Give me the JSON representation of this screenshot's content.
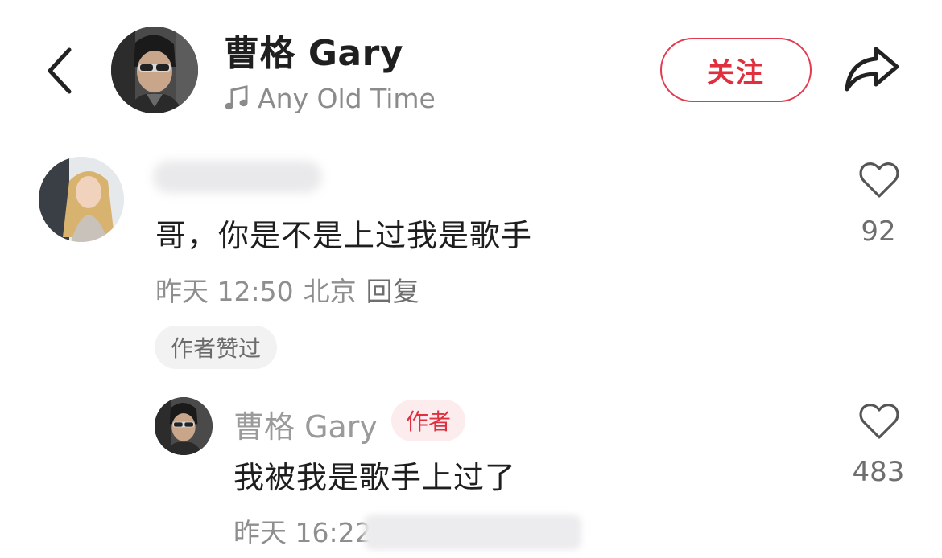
{
  "header": {
    "title": "曹格 Gary",
    "music_title": "Any Old Time",
    "follow_label": "关注",
    "icons": [
      "back-icon",
      "music-note-icon",
      "share-icon"
    ]
  },
  "comment": {
    "text": "哥，你是不是上过我是歌手",
    "time": "昨天 12:50",
    "location": "北京",
    "reply_label": "回复",
    "liked_badge": "作者赞过",
    "like_count": "92"
  },
  "reply": {
    "username": "曹格 Gary",
    "author_badge": "作者",
    "text": "我被我是歌手上过了",
    "time": "昨天 16:22",
    "like_count": "483"
  },
  "colors": {
    "accent": "#e0303f",
    "muted_text": "#8e8e8e",
    "badge_bg": "#f2f2f2",
    "author_badge_bg": "#fdecee"
  }
}
